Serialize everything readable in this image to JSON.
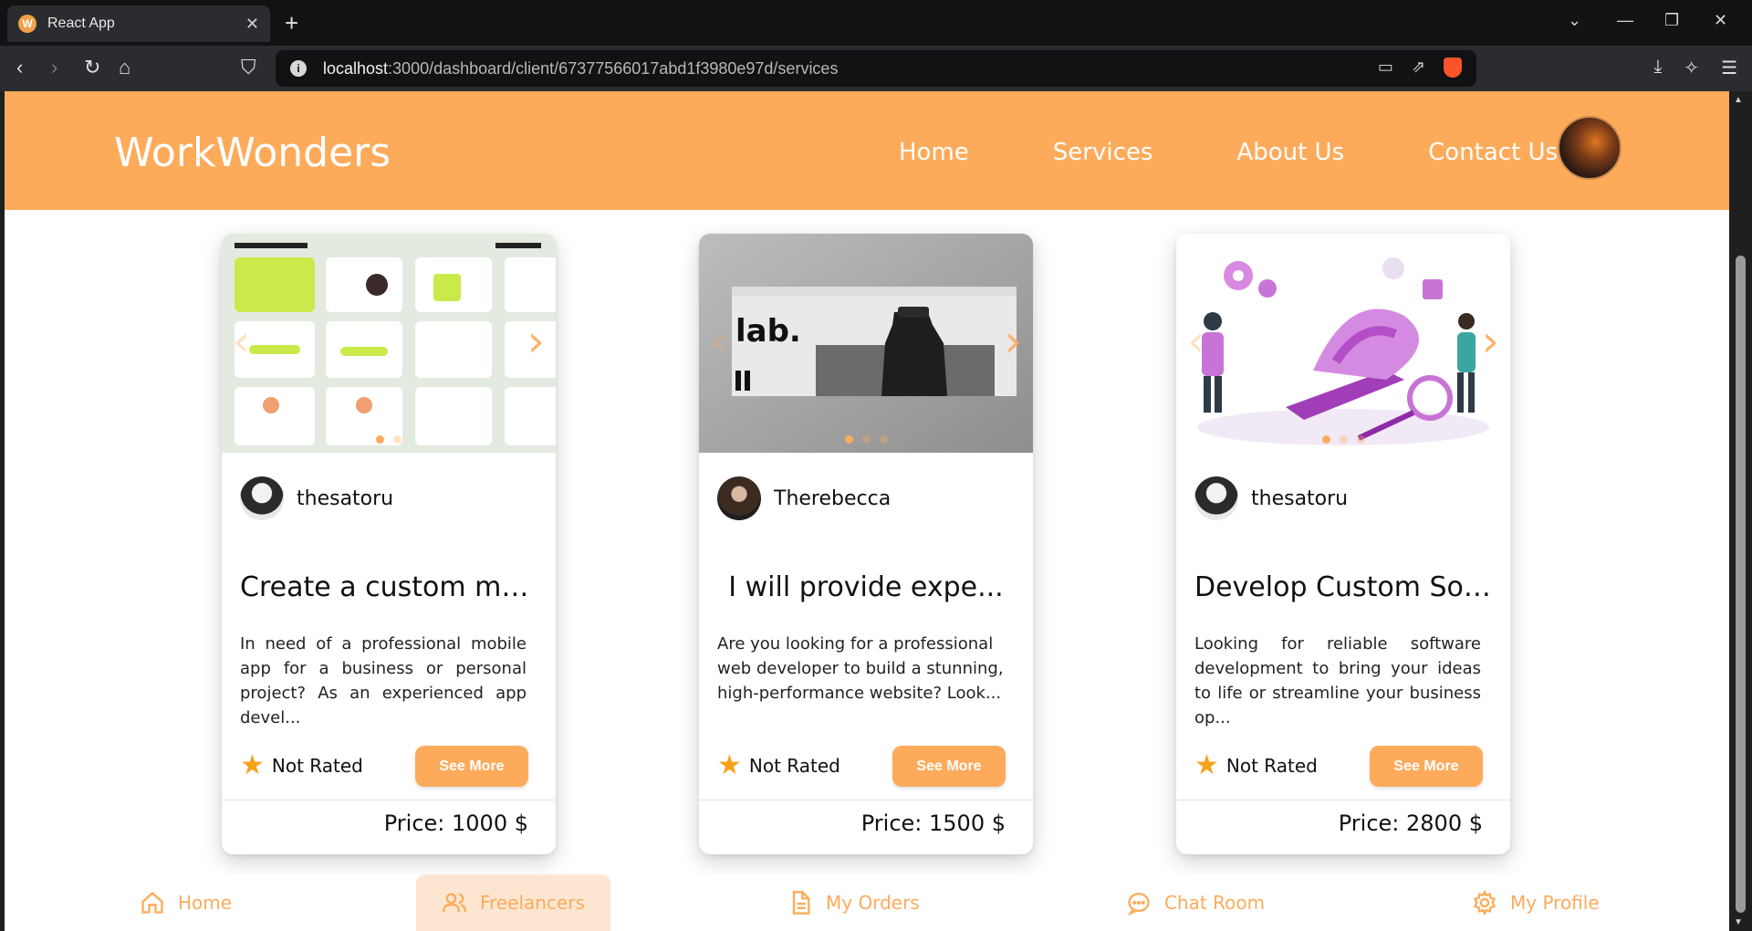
{
  "browser": {
    "tab_title": "React App",
    "tab_favicon_letter": "W",
    "url_host": "localhost",
    "url_path": ":3000/dashboard/client/67377566017abd1f3980e97d/services"
  },
  "header": {
    "brand": "WorkWonders",
    "nav": [
      "Home",
      "Services",
      "About Us",
      "Contact Us"
    ]
  },
  "cards": [
    {
      "seller": "thesatoru",
      "title": "Create a custom mob...",
      "description": "In need of a professional mobile app for a business or personal project? As an experienced app devel...",
      "rating": "Not Rated",
      "button": "See More",
      "price": "Price: 1000 $"
    },
    {
      "seller": "Therebecca",
      "title": "I will provide expe...",
      "description": "Are you looking for a professional web developer to build a stunning, high-performance website? Look...",
      "rating": "Not Rated",
      "button": "See More",
      "price": "Price: 1500 $"
    },
    {
      "seller": "thesatoru",
      "title": "Develop Custom Soft...",
      "description": "Looking for reliable software development to bring your ideas to life or streamline your business op...",
      "rating": "Not Rated",
      "button": "See More",
      "price": "Price: 2800 $"
    }
  ],
  "bottom_nav": [
    "Home",
    "Freelancers",
    "My Orders",
    "Chat Room",
    "My Profile"
  ],
  "colors": {
    "accent": "#fdab5b",
    "accent_light": "#fde6d1",
    "star": "#f7a21b"
  }
}
